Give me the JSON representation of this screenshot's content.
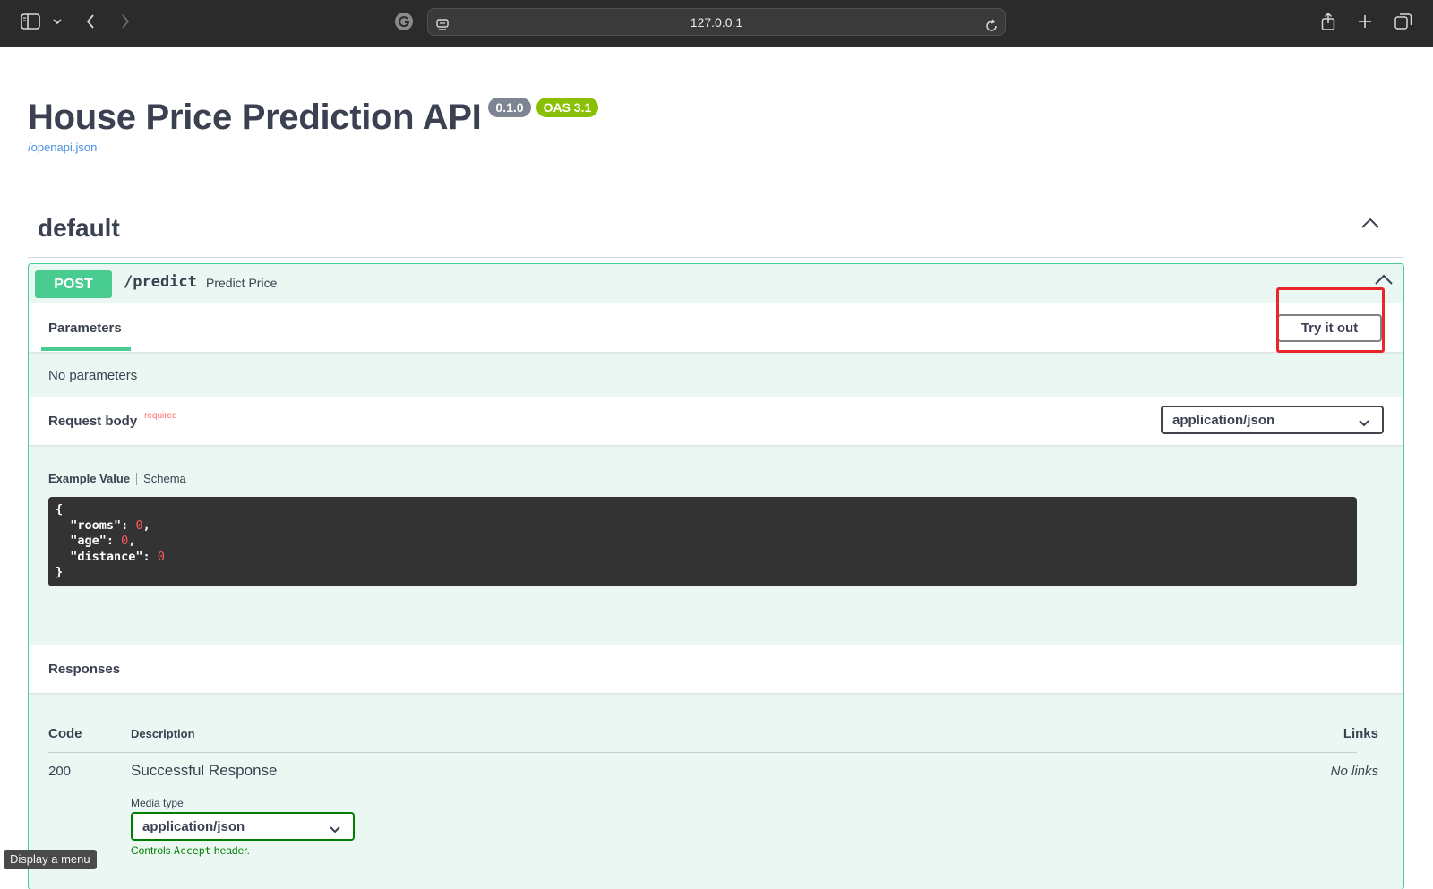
{
  "browser": {
    "url": "127.0.0.1"
  },
  "info": {
    "title": "House Price Prediction API",
    "version": "0.1.0",
    "oas_version": "OAS 3.1",
    "spec_link": "/openapi.json"
  },
  "tag": {
    "name": "default"
  },
  "operation": {
    "method": "POST",
    "path": "/predict",
    "summary": "Predict Price",
    "parameters_tab": "Parameters",
    "try_it_out": "Try it out",
    "no_parameters": "No parameters",
    "request_body_label": "Request body",
    "required_label": "required",
    "request_content_type": "application/json",
    "example_tab": "Example Value",
    "schema_tab": "Schema",
    "example": {
      "open_brace": "{",
      "rooms_key": "\"rooms\"",
      "rooms_value": "0",
      "age_key": "\"age\"",
      "age_value": "0",
      "distance_key": "\"distance\"",
      "distance_value": "0",
      "close_brace": "}"
    }
  },
  "responses": {
    "title": "Responses",
    "headers": {
      "code": "Code",
      "description": "Description",
      "links": "Links"
    },
    "rows": [
      {
        "code": "200",
        "description": "Successful Response",
        "links": "No links",
        "media_type_label": "Media type",
        "media_type": "application/json",
        "controls_prefix": "Controls ",
        "controls_code": "Accept",
        "controls_suffix": " header."
      }
    ]
  },
  "tooltip": "Display a menu",
  "colors": {
    "post": "#49cc90",
    "post_bg": "#ebf7f2",
    "required": "#ff6f6f",
    "highlight": "#e8262b",
    "version_badge": "#7d8492",
    "oas_badge": "#89bf04"
  }
}
